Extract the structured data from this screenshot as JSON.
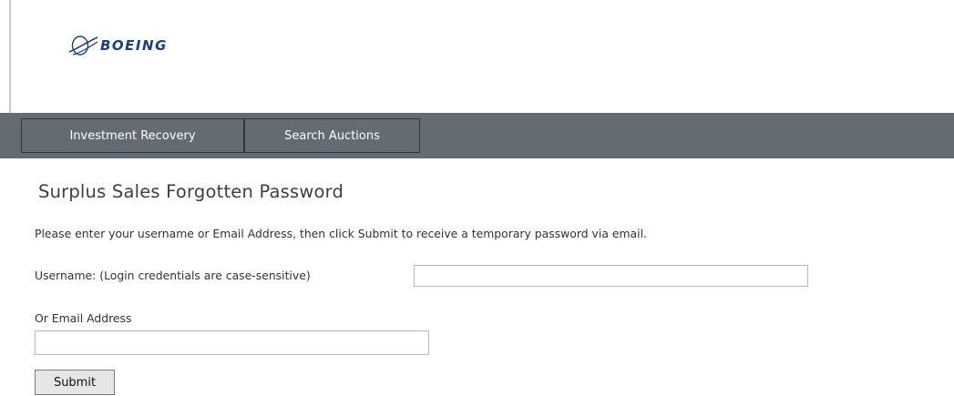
{
  "header": {
    "logo_text": "BOEING",
    "logo_icon": "boeing-globe-icon"
  },
  "nav": {
    "tabs": [
      {
        "label": "Investment Recovery"
      },
      {
        "label": "Search Auctions"
      }
    ]
  },
  "page": {
    "title": "Surplus Sales Forgotten Password",
    "instruction": "Please enter your username or Email Address, then click Submit to receive a temporary password via email."
  },
  "form": {
    "username_label": "Username: (Login credentials are case-sensitive)",
    "username_value": "",
    "email_label": "Or Email Address",
    "email_value": "",
    "submit_label": "Submit"
  },
  "colors": {
    "navbar": "#646c73",
    "logo": "#1d3f7a"
  }
}
